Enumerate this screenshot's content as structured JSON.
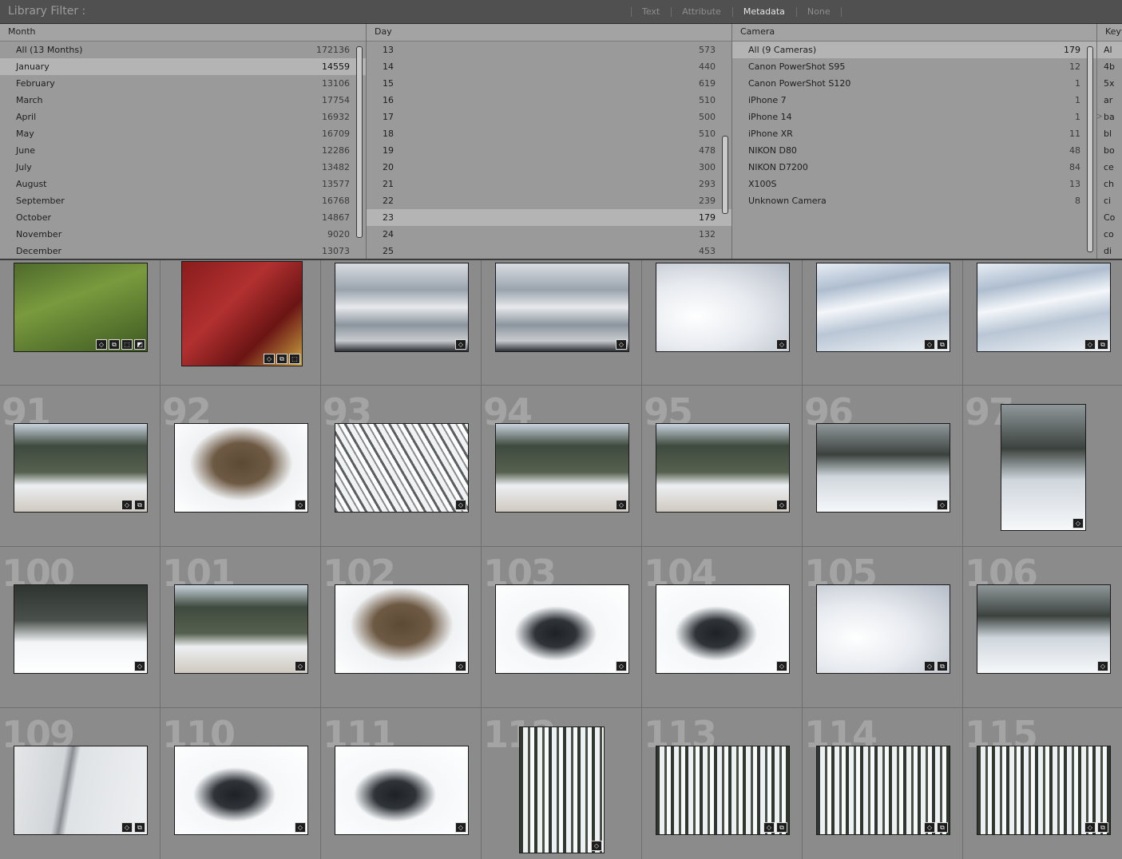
{
  "header": {
    "title": "Library Filter :",
    "modes": [
      {
        "label": "Text",
        "active": false
      },
      {
        "label": "Attribute",
        "active": false
      },
      {
        "label": "Metadata",
        "active": true
      },
      {
        "label": "None",
        "active": false
      }
    ]
  },
  "columns": [
    {
      "id": "month",
      "title": "Month",
      "rows": [
        {
          "label": "All (13 Months)",
          "count": "172136",
          "selected": false
        },
        {
          "label": "January",
          "count": "14559",
          "selected": true
        },
        {
          "label": "February",
          "count": "13106",
          "selected": false
        },
        {
          "label": "March",
          "count": "17754",
          "selected": false
        },
        {
          "label": "April",
          "count": "16932",
          "selected": false
        },
        {
          "label": "May",
          "count": "16709",
          "selected": false
        },
        {
          "label": "June",
          "count": "12286",
          "selected": false
        },
        {
          "label": "July",
          "count": "13482",
          "selected": false
        },
        {
          "label": "August",
          "count": "13577",
          "selected": false
        },
        {
          "label": "September",
          "count": "16768",
          "selected": false
        },
        {
          "label": "October",
          "count": "14867",
          "selected": false
        },
        {
          "label": "November",
          "count": "9020",
          "selected": false
        },
        {
          "label": "December",
          "count": "13073",
          "selected": false
        }
      ]
    },
    {
      "id": "day",
      "title": "Day",
      "rows": [
        {
          "label": "13",
          "count": "573",
          "selected": false
        },
        {
          "label": "14",
          "count": "440",
          "selected": false
        },
        {
          "label": "15",
          "count": "619",
          "selected": false
        },
        {
          "label": "16",
          "count": "510",
          "selected": false
        },
        {
          "label": "17",
          "count": "500",
          "selected": false
        },
        {
          "label": "18",
          "count": "510",
          "selected": false
        },
        {
          "label": "19",
          "count": "478",
          "selected": false
        },
        {
          "label": "20",
          "count": "300",
          "selected": false
        },
        {
          "label": "21",
          "count": "293",
          "selected": false
        },
        {
          "label": "22",
          "count": "239",
          "selected": false
        },
        {
          "label": "23",
          "count": "179",
          "selected": true
        },
        {
          "label": "24",
          "count": "132",
          "selected": false
        },
        {
          "label": "25",
          "count": "453",
          "selected": false
        }
      ]
    },
    {
      "id": "camera",
      "title": "Camera",
      "rows": [
        {
          "label": "All (9 Cameras)",
          "count": "179",
          "selected": true
        },
        {
          "label": "Canon PowerShot S95",
          "count": "12",
          "selected": false
        },
        {
          "label": "Canon PowerShot S120",
          "count": "1",
          "selected": false
        },
        {
          "label": "iPhone 7",
          "count": "1",
          "selected": false
        },
        {
          "label": "iPhone 14",
          "count": "1",
          "selected": false
        },
        {
          "label": "iPhone XR",
          "count": "11",
          "selected": false
        },
        {
          "label": "NIKON D80",
          "count": "48",
          "selected": false
        },
        {
          "label": "NIKON D7200",
          "count": "84",
          "selected": false
        },
        {
          "label": "X100S",
          "count": "13",
          "selected": false
        },
        {
          "label": "Unknown Camera",
          "count": "8",
          "selected": false
        }
      ]
    },
    {
      "id": "keyword",
      "title": "Keyw",
      "rows": [
        {
          "label": "Al",
          "selected": true
        },
        {
          "label": "4b",
          "selected": false
        },
        {
          "label": "5x",
          "selected": false
        },
        {
          "label": "ar",
          "selected": false
        },
        {
          "label": "ba",
          "selected": false
        },
        {
          "label": "bl",
          "selected": false
        },
        {
          "label": "bo",
          "selected": false
        },
        {
          "label": "ce",
          "selected": false
        },
        {
          "label": "ch",
          "selected": false
        },
        {
          "label": "ci",
          "selected": false
        },
        {
          "label": "Co",
          "selected": false
        },
        {
          "label": "co",
          "selected": false
        },
        {
          "label": "di",
          "selected": false
        }
      ]
    }
  ],
  "grid": {
    "rows": [
      [
        {
          "num": "",
          "badges": [
            "tag",
            "copy",
            "crop",
            "edit"
          ],
          "scene": "moss"
        },
        {
          "num": "",
          "badges": [
            "tag",
            "copy",
            "crop"
          ],
          "scene": "books"
        },
        {
          "num": "",
          "badges": [
            "tag"
          ],
          "scene": "sky"
        },
        {
          "num": "",
          "badges": [
            "tag"
          ],
          "scene": "sky"
        },
        {
          "num": "",
          "badges": [
            "tag"
          ],
          "scene": "snowmound"
        },
        {
          "num": "",
          "badges": [
            "tag",
            "copy"
          ],
          "scene": "brightsky"
        },
        {
          "num": "",
          "badges": [
            "tag",
            "copy"
          ],
          "scene": "brightsky"
        }
      ],
      [
        {
          "num": "91",
          "badges": [
            "tag",
            "copy"
          ],
          "scene": "road"
        },
        {
          "num": "92",
          "badges": [
            "tag"
          ],
          "scene": "rock"
        },
        {
          "num": "93",
          "badges": [
            "tag"
          ],
          "scene": "branches"
        },
        {
          "num": "94",
          "badges": [
            "tag"
          ],
          "scene": "road"
        },
        {
          "num": "95",
          "badges": [
            "tag"
          ],
          "scene": "road"
        },
        {
          "num": "96",
          "badges": [
            "tag"
          ],
          "scene": "trail"
        },
        {
          "num": "97",
          "badges": [
            "tag"
          ],
          "scene": "trail",
          "portrait": true
        }
      ],
      [
        {
          "num": "100",
          "badges": [
            "tag"
          ],
          "scene": "sign"
        },
        {
          "num": "101",
          "badges": [
            "tag"
          ],
          "scene": "road"
        },
        {
          "num": "102",
          "badges": [
            "tag"
          ],
          "scene": "rock"
        },
        {
          "num": "103",
          "badges": [
            "tag"
          ],
          "scene": "creek"
        },
        {
          "num": "104",
          "badges": [
            "tag"
          ],
          "scene": "creek"
        },
        {
          "num": "105",
          "badges": [
            "tag",
            "copy"
          ],
          "scene": "snowmound"
        },
        {
          "num": "106",
          "badges": [
            "tag"
          ],
          "scene": "trail"
        }
      ],
      [
        {
          "num": "109",
          "badges": [
            "tag",
            "copy"
          ],
          "scene": "snowfield"
        },
        {
          "num": "110",
          "badges": [
            "tag"
          ],
          "scene": "creek"
        },
        {
          "num": "111",
          "badges": [
            "tag"
          ],
          "scene": "creek"
        },
        {
          "num": "112",
          "badges": [
            "tag"
          ],
          "scene": "forest",
          "portrait": true
        },
        {
          "num": "113",
          "badges": [
            "tag",
            "copy"
          ],
          "scene": "forest"
        },
        {
          "num": "114",
          "badges": [
            "tag",
            "copy"
          ],
          "scene": "forest"
        },
        {
          "num": "115",
          "badges": [
            "tag",
            "copy"
          ],
          "scene": "forest"
        }
      ]
    ]
  }
}
